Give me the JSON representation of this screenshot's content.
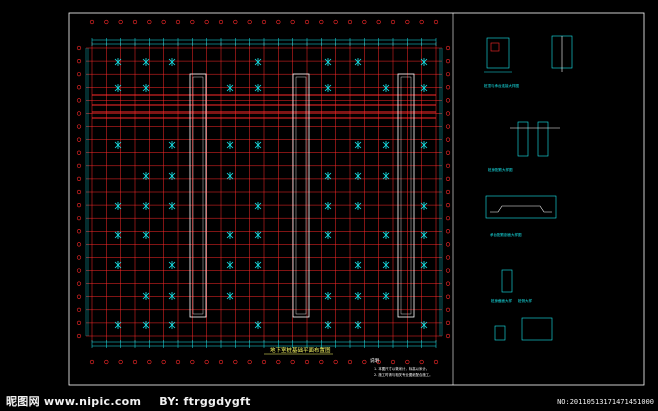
{
  "drawing": {
    "plan_title": "地下室桩基础平面布置图",
    "notes_heading": "说明",
    "notes_lines": [
      "1. 本图尺寸以毫米计，标高以米计。",
      "2. 施工时请与相关专业图纸配合施工。"
    ],
    "details": [
      {
        "caption": "桩顶与承台连接大样图"
      },
      {
        "caption": "桩身配筋大样图"
      },
      {
        "caption": "承台配筋剖面大样图"
      },
      {
        "caption": "桩身截面大样"
      },
      {
        "caption": "桩侧大样"
      }
    ]
  },
  "colors": {
    "background": "#000000",
    "frame": "#ffffff",
    "grid": "#ff2a2a",
    "dimension": "#18e9ee",
    "pile": "#18e9ee",
    "wall": "#ffffff",
    "text": "#ffff66"
  },
  "icons": [
    "pile-cap-icon",
    "axis-bubble-icon"
  ],
  "watermark": {
    "logo_text": "昵图网",
    "site": "www.nipic.com",
    "by": "BY: ftrggdygft",
    "serial": "NO:20110513171471451000"
  }
}
